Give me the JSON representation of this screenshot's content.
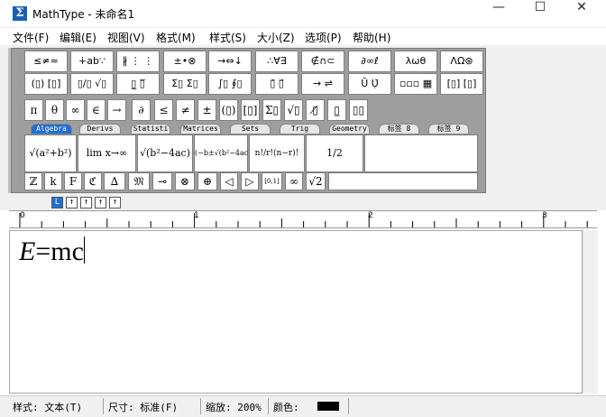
{
  "window": {
    "title": "MathType - 未命名1",
    "icon": "Σ",
    "minimize": "—",
    "maximize": "☐",
    "close": "✕"
  },
  "menu": [
    "文件(F)",
    "编辑(E)",
    "视图(V)",
    "格式(M)",
    "样式(S)",
    "大小(Z)",
    "选项(P)",
    "帮助(H)"
  ],
  "palettes_row1": [
    "≤≠≈",
    "∔ab∵",
    "∦ ⋮ ⋮",
    "±•⊗",
    "→⇔↓",
    "∴∀∃",
    "∉∩⊂",
    "∂∞ℓ",
    "λωθ",
    "ΛΩ⊛"
  ],
  "palettes_row2": [
    "(▯) [▯]",
    "▯/▯ √▯",
    "▯̲ ▯̅",
    "Σ▯ Σ▯",
    "∫▯ ∮▯",
    "▯̄ ▯⃗",
    "→ ⇌",
    "Ū Ụ̇",
    "▫▫▫ ▦",
    "[▯] [▯]"
  ],
  "small_row": [
    "π",
    "θ",
    "∞",
    "∈",
    "→",
    "∂",
    "≤",
    "≠",
    "±",
    "(▯)",
    "[▯]",
    "Σ▯",
    "√▯",
    "▯̸",
    "▯̲",
    "▯▯"
  ],
  "tabs": [
    "Algebra",
    "Derivs",
    "Statisti",
    "Matrices",
    "Sets",
    "Trig",
    "Geometry",
    "标签 8",
    "标签 9"
  ],
  "templates": [
    "√(a²+b²)",
    "lim x→∞",
    "√(b²−4ac)",
    "(−b±√(b²−4ac))/2a",
    "n!/r!(n−r)!",
    "1/2"
  ],
  "bottom_row": [
    "ℤ",
    "k",
    "F",
    "ℭ",
    "∆",
    "𝔐",
    "⊸",
    "⊗",
    "⊕",
    "◁",
    "▷",
    "[0,1]",
    "∞",
    "√2"
  ],
  "tab_stops": [
    "L",
    "↑",
    "↑",
    "↑",
    "↑"
  ],
  "ruler_marks": [
    "0",
    "1",
    "2",
    "3"
  ],
  "equation": {
    "var": "E",
    "rest": "=mc"
  },
  "status": {
    "style": "样式: 文本(T)",
    "size": "尺寸: 标准(F)",
    "zoom": "缩放: 200%",
    "color": "颜色:",
    "color_value": "#000000"
  }
}
